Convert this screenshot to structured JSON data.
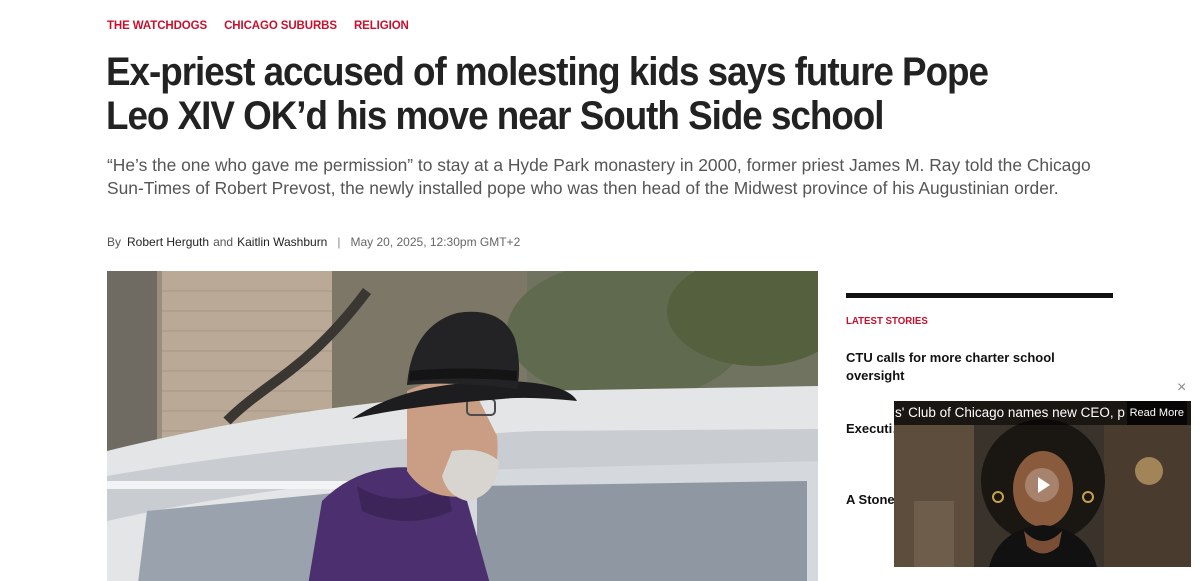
{
  "tags": [
    "THE WATCHDOGS",
    "CHICAGO SUBURBS",
    "RELIGION"
  ],
  "headline": "Ex-priest accused of molesting kids says future Pope Leo XIV OK’d his move near South Side school",
  "dek": "“He’s the one who gave me permission” to stay at a Hyde Park monastery in 2000, former priest James M. Ray told the Chicago Sun-Times of Robert Prevost, the newly installed pope who was then head of the Midwest province of his Augustinian order.",
  "byline": {
    "by": "By",
    "author1": "Robert Herguth",
    "and": "and",
    "author2": "Kaitlin Washburn",
    "separator": "|",
    "date": "May 20, 2025, 12:30pm GMT+2"
  },
  "sidebar": {
    "heading": "LATEST STORIES",
    "stories": [
      "CTU calls for more charter school oversight",
      "Executi… CEO, pr…",
      "A Stone… handica… UNC op…"
    ]
  },
  "video": {
    "caption": "s' Club of Chicago names new CEO, p",
    "read_more": "Read More",
    "close": "×"
  }
}
